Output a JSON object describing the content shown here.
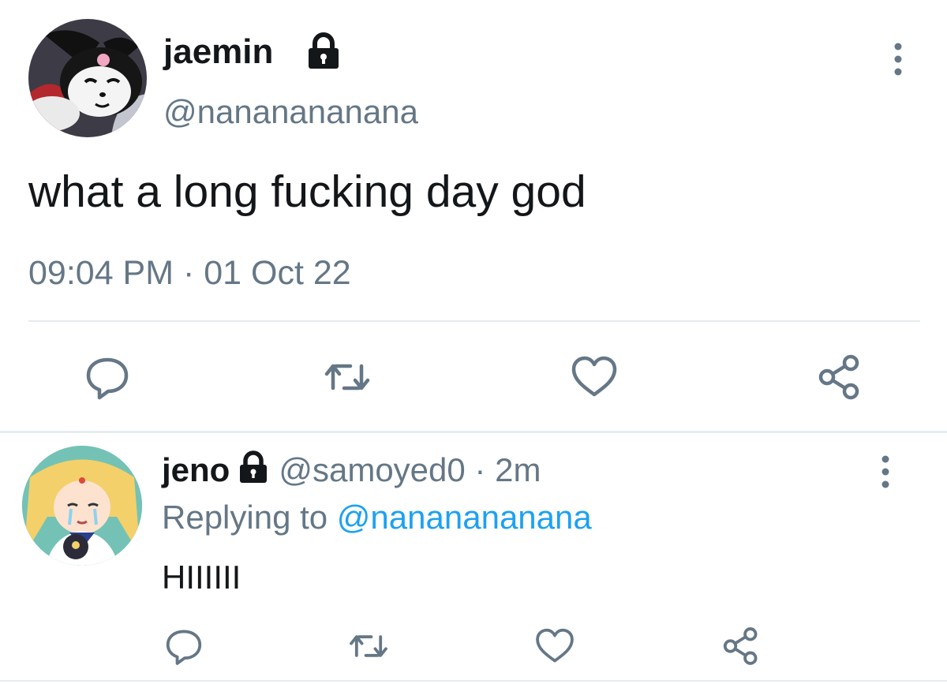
{
  "main_tweet": {
    "display_name": "jaemin",
    "handle": "@nananananana",
    "text": "what a long fucking day god",
    "timestamp": "09:04 PM · 01 Oct 22",
    "avatar_icon": "kuromi-avatar",
    "locked_icon": "lock-icon",
    "actions": [
      "reply-icon",
      "retweet-icon",
      "like-icon",
      "share-icon"
    ]
  },
  "reply": {
    "display_name": "jeno",
    "handle": "@samoyed0",
    "separator": " · ",
    "time_ago": "2m",
    "replying_prefix": "Replying to ",
    "replying_to": "@nananananana",
    "text": "HIIIIII",
    "avatar_icon": "sailor-moon-avatar",
    "locked_icon": "lock-icon",
    "actions": [
      "reply-icon",
      "retweet-icon",
      "like-icon",
      "share-icon"
    ]
  },
  "colors": {
    "text": "#14171a",
    "secondary": "#657786",
    "link": "#1da1f2",
    "divider": "#e6ecf0"
  }
}
